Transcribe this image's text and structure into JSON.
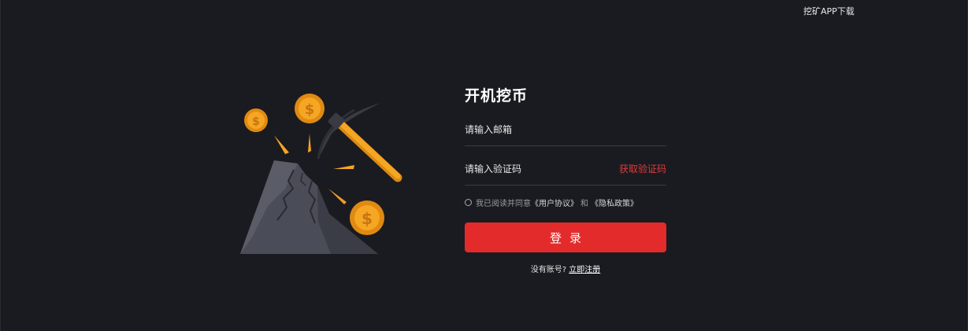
{
  "header": {
    "download_link": "挖矿APP下载"
  },
  "illustration": {
    "icon": "mining-pickaxe-coins-icon",
    "colors": {
      "rock": "#4a4c57",
      "rock_shadow": "#363842",
      "coin": "#f5a623",
      "pickaxe_handle": "#f5a623",
      "pickaxe_head": "#3a3b42"
    }
  },
  "login": {
    "title": "开机挖币",
    "email_placeholder": "请输入邮箱",
    "code_placeholder": "请输入验证码",
    "get_code_label": "获取验证码",
    "agree_prefix": "我已阅读并同意",
    "user_agreement": "《用户协议》",
    "and": "和",
    "privacy_policy": "《隐私政策》",
    "submit_label": "登录",
    "no_account": "没有账号?",
    "register_link": "立即注册"
  },
  "colors": {
    "background": "#1a1b20",
    "accent": "#e42b2b",
    "accent_text": "#e23a3a"
  }
}
